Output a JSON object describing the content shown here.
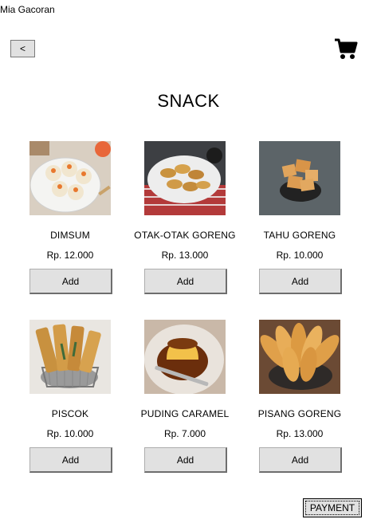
{
  "window": {
    "title": "Mia Gacoran"
  },
  "toolbar": {
    "back_label": "<",
    "cart_icon": "cart-icon"
  },
  "page": {
    "title": "SNACK"
  },
  "products": [
    {
      "name": "DIMSUM",
      "price": "Rp. 12.000",
      "add_label": "Add"
    },
    {
      "name": "OTAK-OTAK GORENG",
      "price": "Rp. 13.000",
      "add_label": "Add"
    },
    {
      "name": "TAHU GORENG",
      "price": "Rp. 10.000",
      "add_label": "Add"
    },
    {
      "name": "PISCOK",
      "price": "Rp. 10.000",
      "add_label": "Add"
    },
    {
      "name": "PUDING CARAMEL",
      "price": "Rp. 7.000",
      "add_label": "Add"
    },
    {
      "name": "PISANG GORENG",
      "price": "Rp. 13.000",
      "add_label": "Add"
    }
  ],
  "footer": {
    "payment_label": "PAYMENT"
  },
  "colors": {
    "background": "#ffffff",
    "button_face": "#e1e1e1",
    "button_border": "#adadad"
  }
}
